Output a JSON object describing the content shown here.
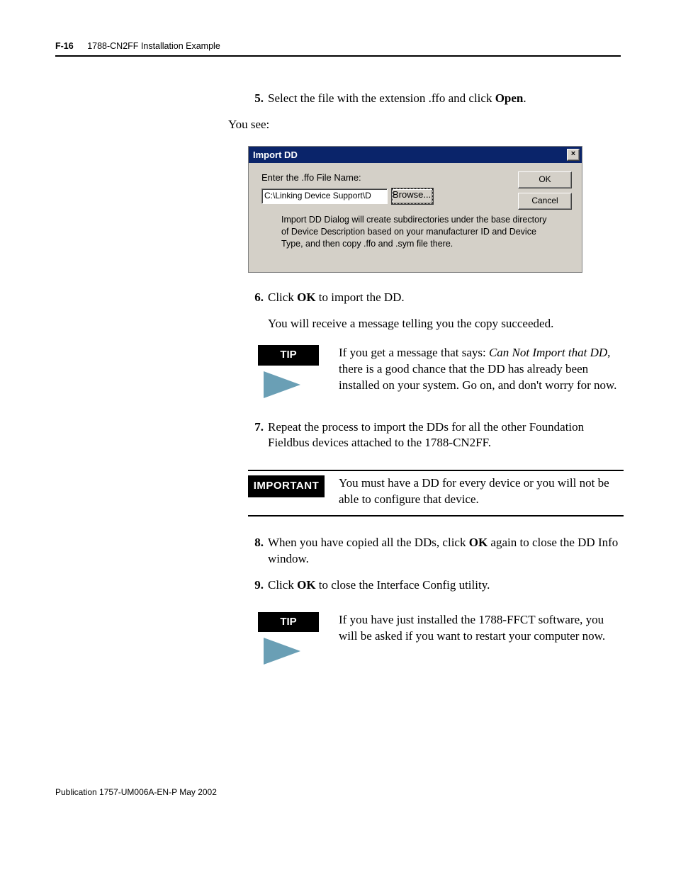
{
  "header": {
    "page_no": "F-16",
    "title": "1788-CN2FF Installation Example"
  },
  "step5": {
    "num": "5.",
    "pre": "Select the file with the extension .ffo and click ",
    "bold": "Open",
    "post": "."
  },
  "you_see": "You see:",
  "dialog": {
    "title": "Import DD",
    "close": "×",
    "label": "Enter the .ffo File Name:",
    "path": "C:\\Linking Device Support\\D",
    "browse": "Browse...",
    "ok": "OK",
    "cancel": "Cancel",
    "desc": "Import DD Dialog will create subdirectories under the base directory of Device Description based on your manufacturer ID and Device Type,  and then copy .ffo and .sym file there."
  },
  "step6": {
    "num": "6.",
    "pre": "Click ",
    "bold": "OK",
    "post": " to import the DD.",
    "follow": "You will receive a message telling you the copy succeeded."
  },
  "tip1": {
    "badge": "TIP",
    "pre": "If you get a message that says: ",
    "italic": "Can Not Import that DD",
    "post": ", there is a good chance that the DD has already been installed on your system. Go on, and don't worry for now."
  },
  "step7": {
    "num": "7.",
    "text": "Repeat the process to import the DDs for all the other Foundation Fieldbus devices attached to the 1788-CN2FF."
  },
  "important": {
    "badge": "IMPORTANT",
    "text": "You must have a DD for every device or you will not be able to configure that device."
  },
  "step8": {
    "num": "8.",
    "pre": "When you have copied all the DDs, click ",
    "bold": "OK",
    "post": " again to close the DD Info window."
  },
  "step9": {
    "num": "9.",
    "pre": "Click ",
    "bold": "OK",
    "post": " to close the Interface Config utility."
  },
  "tip2": {
    "badge": "TIP",
    "text": "If you have just installed the 1788-FFCT software, you will be asked if you want to restart your computer now."
  },
  "footer": "Publication 1757-UM006A-EN-P May 2002"
}
